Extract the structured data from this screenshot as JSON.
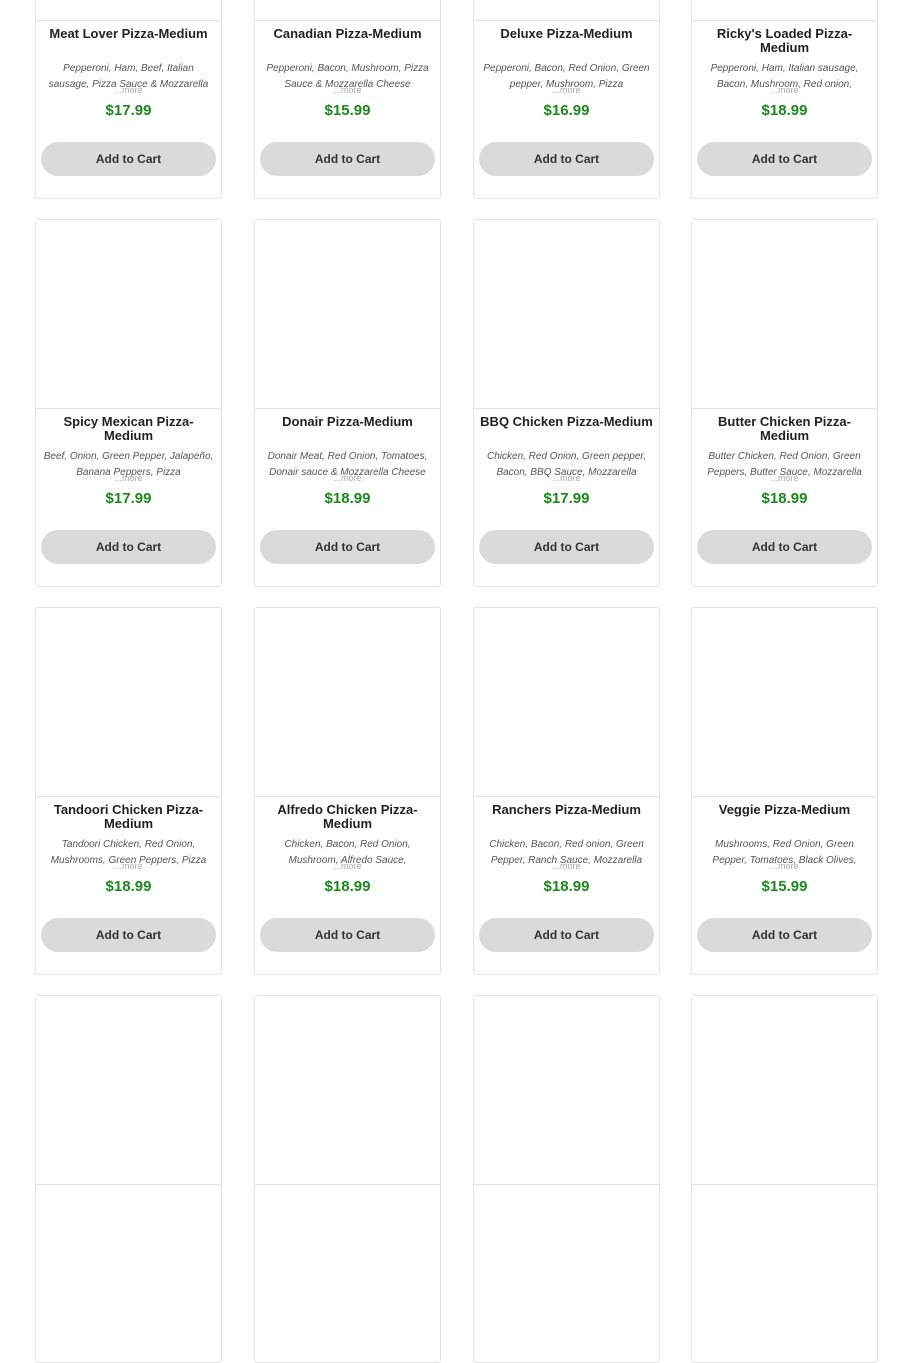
{
  "products": [
    {
      "name": "Meat Lover Pizza-Medium",
      "desc": "Pepperoni, Ham, Beef, Italian sausage, Pizza Sauce & Mozzarella Cheese",
      "price": "$17.99",
      "more": "...more",
      "button": "Add to Cart"
    },
    {
      "name": "Canadian Pizza-Medium",
      "desc": "Pepperoni, Bacon, Mushroom, Pizza Sauce & Mozzarella Cheese",
      "price": "$15.99",
      "more": "...more",
      "button": "Add to Cart"
    },
    {
      "name": "Deluxe Pizza-Medium",
      "desc": "Pepperoni, Bacon, Red Onion, Green pepper, Mushroom, Pizza",
      "price": "$16.99",
      "more": "...more",
      "button": "Add to Cart"
    },
    {
      "name": "Ricky's Loaded Pizza-Medium",
      "desc": "Pepperoni, Ham, Italian sausage, Bacon, Mushroom, Red onion,",
      "price": "$18.99",
      "more": "...more",
      "button": "Add to Cart"
    },
    {
      "name": "Spicy Mexican Pizza-Medium",
      "desc": "Beef, Onion, Green Pepper, Jalapeño, Banana Peppers, Pizza",
      "price": "$17.99",
      "more": "...more",
      "button": "Add to Cart"
    },
    {
      "name": "Donair Pizza-Medium",
      "desc": "Donair Meat, Red Onion, Tomatoes, Donair sauce & Mozzarella Cheese",
      "price": "$18.99",
      "more": "...more",
      "button": "Add to Cart"
    },
    {
      "name": "BBQ Chicken Pizza-Medium",
      "desc": "Chicken, Red Onion, Green pepper, Bacon, BBQ Sauce, Mozzarella",
      "price": "$17.99",
      "more": "...more",
      "button": "Add to Cart"
    },
    {
      "name": "Butter Chicken Pizza-Medium",
      "desc": "Butter Chicken, Red Onion, Green Peppers, Butter Sauce, Mozzarella",
      "price": "$18.99",
      "more": "...more",
      "button": "Add to Cart"
    },
    {
      "name": "Tandoori Chicken Pizza-Medium",
      "desc": "Tandoori Chicken, Red Onion, Mushrooms, Green Peppers, Pizza",
      "price": "$18.99",
      "more": "...more",
      "button": "Add to Cart"
    },
    {
      "name": "Alfredo Chicken Pizza-Medium",
      "desc": "Chicken, Bacon, Red Onion, Mushroom, Alfredo Sauce,",
      "price": "$18.99",
      "more": "...more",
      "button": "Add to Cart"
    },
    {
      "name": "Ranchers Pizza-Medium",
      "desc": "Chicken, Bacon, Red onion, Green Pepper, Ranch Sauce, Mozzarella",
      "price": "$18.99",
      "more": "...more",
      "button": "Add to Cart"
    },
    {
      "name": "Veggie Pizza-Medium",
      "desc": "Mushrooms, Red Onion, Green Pepper, Tomatoes, Black Olives,",
      "price": "$15.99",
      "more": "...more",
      "button": "Add to Cart"
    }
  ]
}
